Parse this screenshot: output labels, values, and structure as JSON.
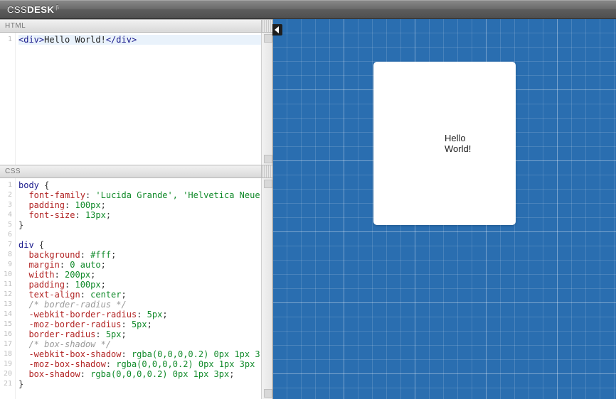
{
  "header": {
    "logo_light": "CSS",
    "logo_bold": "DESK",
    "logo_beta": "β"
  },
  "panels": {
    "html_label": "HTML",
    "css_label": "CSS"
  },
  "html_editor": {
    "lines": [
      {
        "n": "1",
        "tokens": [
          {
            "t": "<div>",
            "c": "tk-tag"
          },
          {
            "t": "Hello World!",
            "c": "tk-txt"
          },
          {
            "t": "</div>",
            "c": "tk-tag"
          }
        ],
        "active": true
      }
    ]
  },
  "css_editor": {
    "lines": [
      {
        "n": "1",
        "tokens": [
          {
            "t": "body",
            "c": "tk-sel"
          },
          {
            "t": " {",
            "c": "tk-punc"
          }
        ]
      },
      {
        "n": "2",
        "tokens": [
          {
            "t": "  ",
            "c": ""
          },
          {
            "t": "font-family",
            "c": "tk-prop"
          },
          {
            "t": ": ",
            "c": "tk-punc"
          },
          {
            "t": "'Lucida Grande', 'Helvetica Neue'",
            "c": "tk-val"
          }
        ]
      },
      {
        "n": "3",
        "tokens": [
          {
            "t": "  ",
            "c": ""
          },
          {
            "t": "padding",
            "c": "tk-prop"
          },
          {
            "t": ": ",
            "c": "tk-punc"
          },
          {
            "t": "100px",
            "c": "tk-val"
          },
          {
            "t": ";",
            "c": "tk-punc"
          }
        ]
      },
      {
        "n": "4",
        "tokens": [
          {
            "t": "  ",
            "c": ""
          },
          {
            "t": "font-size",
            "c": "tk-prop"
          },
          {
            "t": ": ",
            "c": "tk-punc"
          },
          {
            "t": "13px",
            "c": "tk-val"
          },
          {
            "t": ";",
            "c": "tk-punc"
          }
        ]
      },
      {
        "n": "5",
        "tokens": [
          {
            "t": "}",
            "c": "tk-punc"
          }
        ]
      },
      {
        "n": "6",
        "tokens": [
          {
            "t": "",
            "c": ""
          }
        ]
      },
      {
        "n": "7",
        "tokens": [
          {
            "t": "div",
            "c": "tk-sel"
          },
          {
            "t": " {",
            "c": "tk-punc"
          }
        ]
      },
      {
        "n": "8",
        "tokens": [
          {
            "t": "  ",
            "c": ""
          },
          {
            "t": "background",
            "c": "tk-prop"
          },
          {
            "t": ": ",
            "c": "tk-punc"
          },
          {
            "t": "#fff",
            "c": "tk-val"
          },
          {
            "t": ";",
            "c": "tk-punc"
          }
        ]
      },
      {
        "n": "9",
        "tokens": [
          {
            "t": "  ",
            "c": ""
          },
          {
            "t": "margin",
            "c": "tk-prop"
          },
          {
            "t": ": ",
            "c": "tk-punc"
          },
          {
            "t": "0 auto",
            "c": "tk-val"
          },
          {
            "t": ";",
            "c": "tk-punc"
          }
        ]
      },
      {
        "n": "10",
        "tokens": [
          {
            "t": "  ",
            "c": ""
          },
          {
            "t": "width",
            "c": "tk-prop"
          },
          {
            "t": ": ",
            "c": "tk-punc"
          },
          {
            "t": "200px",
            "c": "tk-val"
          },
          {
            "t": ";",
            "c": "tk-punc"
          }
        ]
      },
      {
        "n": "11",
        "tokens": [
          {
            "t": "  ",
            "c": ""
          },
          {
            "t": "padding",
            "c": "tk-prop"
          },
          {
            "t": ": ",
            "c": "tk-punc"
          },
          {
            "t": "100px",
            "c": "tk-val"
          },
          {
            "t": ";",
            "c": "tk-punc"
          }
        ]
      },
      {
        "n": "12",
        "tokens": [
          {
            "t": "  ",
            "c": ""
          },
          {
            "t": "text-align",
            "c": "tk-prop"
          },
          {
            "t": ": ",
            "c": "tk-punc"
          },
          {
            "t": "center",
            "c": "tk-val"
          },
          {
            "t": ";",
            "c": "tk-punc"
          }
        ]
      },
      {
        "n": "13",
        "tokens": [
          {
            "t": "  ",
            "c": ""
          },
          {
            "t": "/* border-radius */",
            "c": "tk-com"
          }
        ]
      },
      {
        "n": "14",
        "tokens": [
          {
            "t": "  ",
            "c": ""
          },
          {
            "t": "-webkit-border-radius",
            "c": "tk-prop"
          },
          {
            "t": ": ",
            "c": "tk-punc"
          },
          {
            "t": "5px",
            "c": "tk-val"
          },
          {
            "t": ";",
            "c": "tk-punc"
          }
        ]
      },
      {
        "n": "15",
        "tokens": [
          {
            "t": "  ",
            "c": ""
          },
          {
            "t": "-moz-border-radius",
            "c": "tk-prop"
          },
          {
            "t": ": ",
            "c": "tk-punc"
          },
          {
            "t": "5px",
            "c": "tk-val"
          },
          {
            "t": ";",
            "c": "tk-punc"
          }
        ]
      },
      {
        "n": "16",
        "tokens": [
          {
            "t": "  ",
            "c": ""
          },
          {
            "t": "border-radius",
            "c": "tk-prop"
          },
          {
            "t": ": ",
            "c": "tk-punc"
          },
          {
            "t": "5px",
            "c": "tk-val"
          },
          {
            "t": ";",
            "c": "tk-punc"
          }
        ]
      },
      {
        "n": "17",
        "tokens": [
          {
            "t": "  ",
            "c": ""
          },
          {
            "t": "/* box-shadow */",
            "c": "tk-com"
          }
        ]
      },
      {
        "n": "18",
        "tokens": [
          {
            "t": "  ",
            "c": ""
          },
          {
            "t": "-webkit-box-shadow",
            "c": "tk-prop"
          },
          {
            "t": ": ",
            "c": "tk-punc"
          },
          {
            "t": "rgba(0,0,0,0.2) 0px 1px 3",
            "c": "tk-val"
          }
        ]
      },
      {
        "n": "19",
        "tokens": [
          {
            "t": "  ",
            "c": ""
          },
          {
            "t": "-moz-box-shadow",
            "c": "tk-prop"
          },
          {
            "t": ": ",
            "c": "tk-punc"
          },
          {
            "t": "rgba(0,0,0,0.2) 0px 1px 3px",
            "c": "tk-val"
          }
        ]
      },
      {
        "n": "20",
        "tokens": [
          {
            "t": "  ",
            "c": ""
          },
          {
            "t": "box-shadow",
            "c": "tk-prop"
          },
          {
            "t": ": ",
            "c": "tk-punc"
          },
          {
            "t": "rgba(0,0,0,0.2) 0px 1px 3px",
            "c": "tk-val"
          },
          {
            "t": ";",
            "c": "tk-punc"
          }
        ]
      },
      {
        "n": "21",
        "tokens": [
          {
            "t": "}",
            "c": "tk-punc"
          }
        ]
      }
    ]
  },
  "preview": {
    "hello_text": "Hello World!"
  }
}
